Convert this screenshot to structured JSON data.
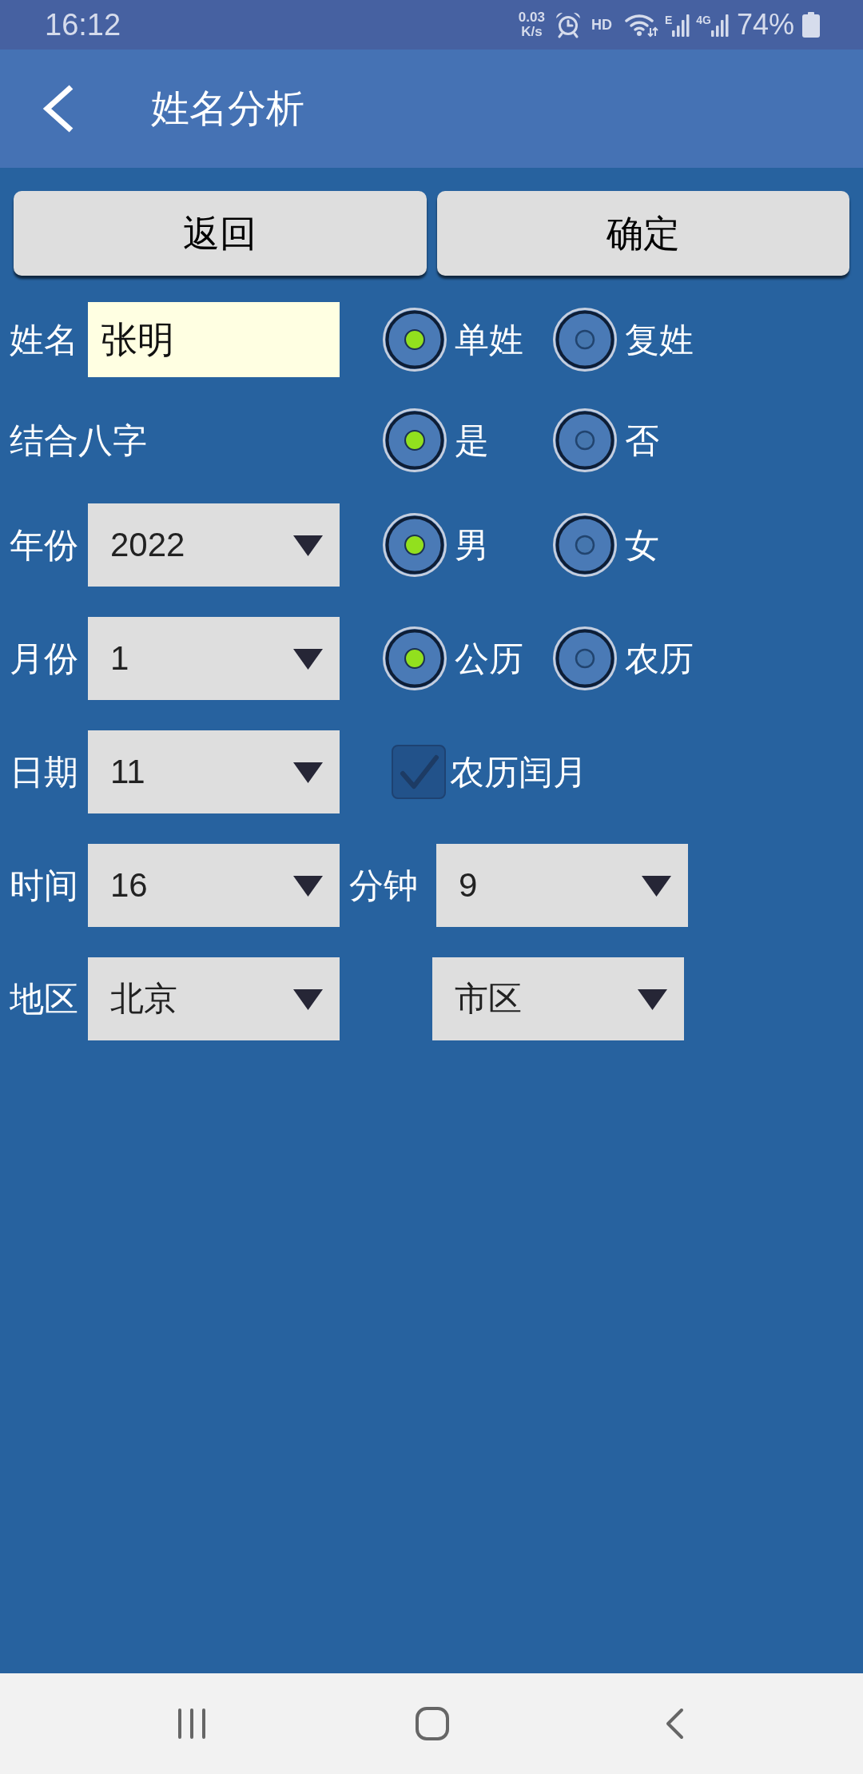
{
  "status_bar": {
    "time": "16:12",
    "net_speed": "0.03",
    "net_unit": "K/s",
    "hd": "HD",
    "sim1": "E",
    "sim2": "4G",
    "battery": "74%"
  },
  "header": {
    "title": "姓名分析"
  },
  "buttons": [
    {
      "label": "返回"
    },
    {
      "label": "确定"
    }
  ],
  "form": [
    {
      "kind": "text",
      "label": "姓名",
      "value": "张明",
      "extra": {
        "kind": "radio",
        "options": [
          {
            "label": "单姓",
            "selected": true
          },
          {
            "label": "复姓",
            "selected": false
          }
        ]
      }
    },
    {
      "kind": "plain",
      "label": "结合八字",
      "extra": {
        "kind": "radio",
        "options": [
          {
            "label": "是",
            "selected": true
          },
          {
            "label": "否",
            "selected": false
          }
        ]
      }
    },
    {
      "kind": "select",
      "label": "年份",
      "value": "2022",
      "extra": {
        "kind": "radio",
        "options": [
          {
            "label": "男",
            "selected": true
          },
          {
            "label": "女",
            "selected": false
          }
        ]
      }
    },
    {
      "kind": "select",
      "label": "月份",
      "value": "1",
      "extra": {
        "kind": "radio",
        "options": [
          {
            "label": "公历",
            "selected": true
          },
          {
            "label": "农历",
            "selected": false
          }
        ]
      }
    },
    {
      "kind": "select",
      "label": "日期",
      "value": "11",
      "extra": {
        "kind": "checkbox",
        "label": "农历闰月",
        "checked": true
      }
    },
    {
      "kind": "select",
      "label": "时间",
      "value": "16",
      "extra": {
        "kind": "select",
        "label": "分钟",
        "value": "9"
      }
    },
    {
      "kind": "select",
      "label": "地区",
      "value": "北京",
      "extra": {
        "kind": "select",
        "value": "市区"
      }
    }
  ]
}
